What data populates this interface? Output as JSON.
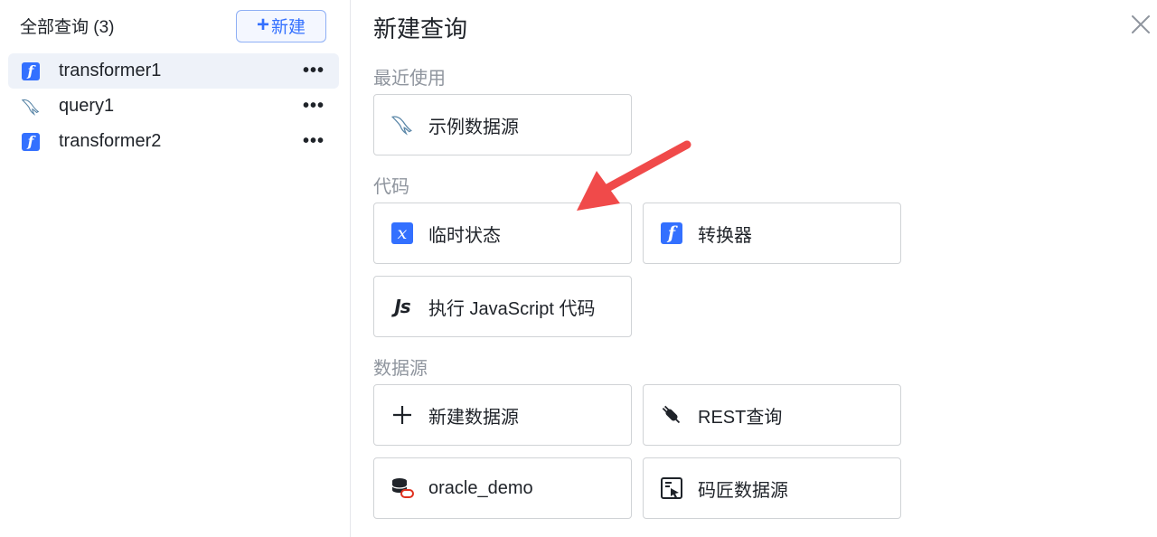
{
  "sidebar": {
    "title": "全部查询 (3)",
    "new_button": {
      "plus": "+",
      "label": "新建"
    },
    "queries": [
      {
        "name": "transformer1",
        "icon": "transformer-icon",
        "more": "•••"
      },
      {
        "name": "query1",
        "icon": "mysql-dolphin-icon",
        "more": "•••"
      },
      {
        "name": "transformer2",
        "icon": "transformer-icon",
        "more": "•••"
      }
    ]
  },
  "panel": {
    "title": "新建查询",
    "sections": {
      "recent": "最近使用",
      "code": "代码",
      "datasource": "数据源"
    },
    "cards": {
      "sample_datasource": "示例数据源",
      "temp_state": "临时状态",
      "transformer": "转换器",
      "run_js": "执行 JavaScript 代码",
      "new_datasource": "新建数据源",
      "rest_query": "REST查询",
      "oracle_demo": "oracle_demo",
      "majiang_datasource": "码匠数据源"
    },
    "icon_glyphs": {
      "f": "f",
      "x": "x",
      "js": "Js"
    }
  },
  "colors": {
    "accent": "#3370ff",
    "active_bg": "#eef2f9",
    "arrow": "#f04a4a",
    "muted_text": "#8f959e",
    "border": "#d0d3d6"
  }
}
